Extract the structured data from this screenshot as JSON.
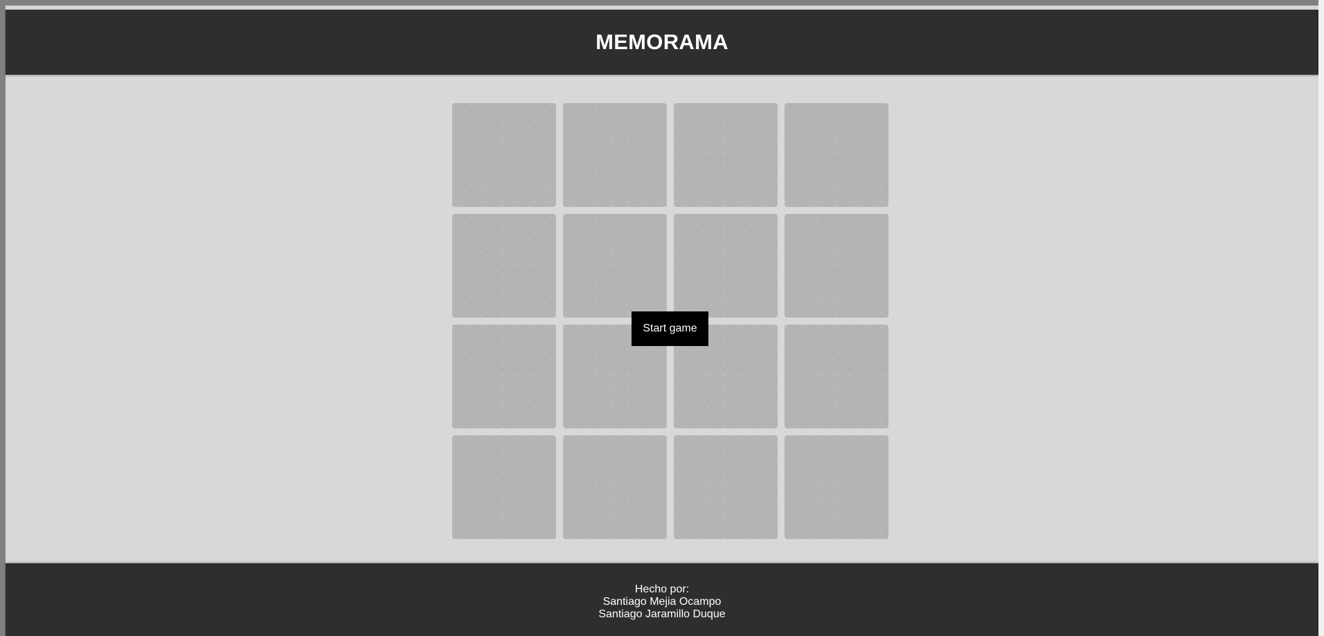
{
  "header": {
    "title": "MEMORAMA"
  },
  "board": {
    "rows": 4,
    "columns": 4,
    "cards": [
      {
        "state": "face-down"
      },
      {
        "state": "face-down"
      },
      {
        "state": "face-down"
      },
      {
        "state": "face-down"
      },
      {
        "state": "face-down"
      },
      {
        "state": "face-down"
      },
      {
        "state": "face-down"
      },
      {
        "state": "face-down"
      },
      {
        "state": "face-down"
      },
      {
        "state": "face-down"
      },
      {
        "state": "face-down"
      },
      {
        "state": "face-down"
      },
      {
        "state": "face-down"
      },
      {
        "state": "face-down"
      },
      {
        "state": "face-down"
      },
      {
        "state": "face-down"
      }
    ]
  },
  "start_button": {
    "label": "Start game"
  },
  "footer": {
    "made_by_label": "Hecho por:",
    "authors": [
      "Santiago Mejia Ocampo",
      "Santiago Jaramillo Duque"
    ]
  },
  "colors": {
    "header_bg": "#2e2e2e",
    "page_bg": "#d8d8d8",
    "card_back": "#b4b4b4",
    "button_bg": "#000000",
    "text_light": "#ffffff"
  }
}
